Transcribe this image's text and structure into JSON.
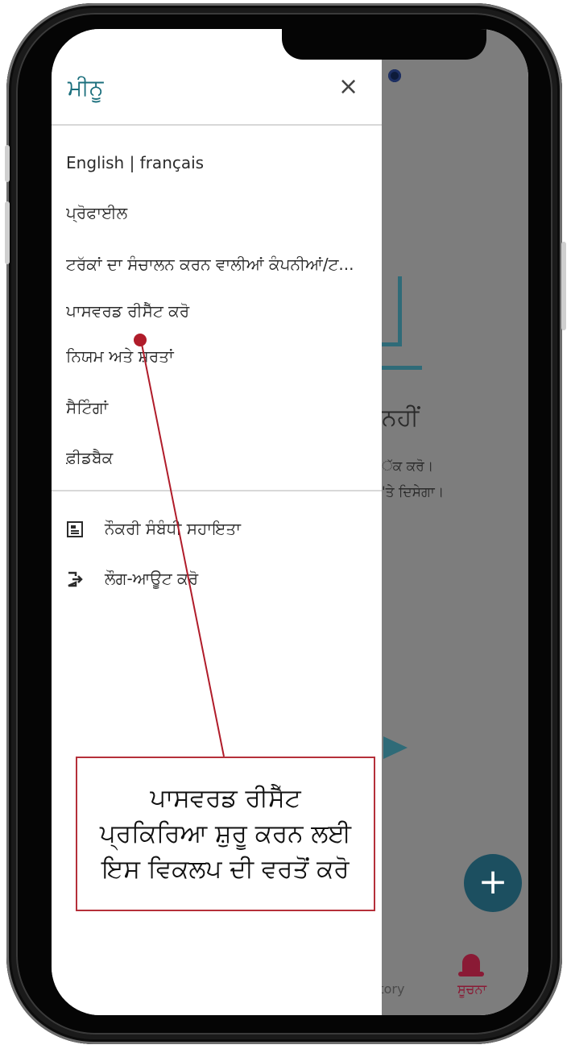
{
  "drawer": {
    "title": "ਮੀਨੂ",
    "close_icon": "×",
    "items": [
      {
        "label": "English | français"
      },
      {
        "label": "ਪ੍ਰੋਫਾਈਲ"
      },
      {
        "label": "ਟਰੱਕਾਂ ਦਾ ਸੰਚਾਲਨ ਕਰਨ ਵਾਲੀਆਂ ਕੰਪਨੀਆਂ/ਟ..."
      },
      {
        "label": "ਪਾਸਵਰਡ ਰੀਸੈੱਟ ਕਰੋ"
      },
      {
        "label": "ਨਿਯਮ ਅਤੇ ਸ਼ਰਤਾਂ"
      },
      {
        "label": "ਸੈਟਿੰਗਾਂ"
      },
      {
        "label": "ਫ਼ੀਡਬੈਕ"
      }
    ],
    "secondary_items": [
      {
        "label": "ਨੌਕਰੀ ਸੰਬੰਧੀ ਸਹਾਇਤਾ",
        "icon": "job-support-icon"
      },
      {
        "label": "ਲੌਗ-ਆਊਟ ਕਰੋ",
        "icon": "logout-icon"
      }
    ]
  },
  "background": {
    "heading": "ਨਹੀਂ",
    "text1": "ੱਕ ਕਰੋ।",
    "text2": "'ਤੇ ਦਿਸੇਗਾ।",
    "fab_label": "+",
    "nav_history": "story",
    "nav_notice": "ਸੂਚਨਾ"
  },
  "callout": {
    "text": "ਪਾਸਵਰਡ ਰੀਸੈੱਟ ਪ੍ਰਕਿਰਿਆ ਸ਼ੁਰੂ ਕਰਨ ਲਈ ਇਸ ਵਿਕਲਪ ਦੀ ਵਰਤੋਂ ਕਰੋ"
  },
  "colors": {
    "accent": "#1b6f7d",
    "callout_red": "#b01c2a",
    "fab": "#1c4f60",
    "notice": "#8a1a35"
  }
}
